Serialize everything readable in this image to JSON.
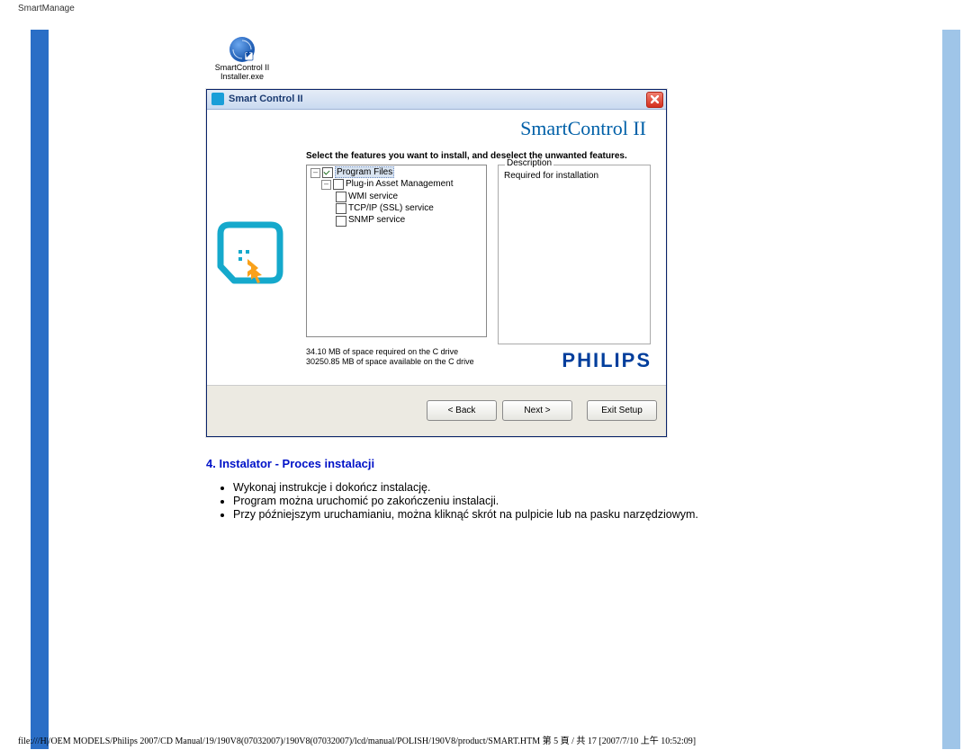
{
  "page_title": "SmartManage",
  "desktop_icon": {
    "line1": "SmartControl II",
    "line2": "Installer.exe"
  },
  "dialog": {
    "title": "Smart Control II",
    "brand_title": "SmartControl II",
    "instruction": "Select the features you want to install, and deselect the unwanted features.",
    "tree": {
      "program_files": "Program Files",
      "plugin_asset": "Plug-in Asset Management",
      "wmi": "WMI service",
      "tcpip": "TCP/IP (SSL) service",
      "snmp": "SNMP service"
    },
    "description": {
      "legend": "Description",
      "text": "Required for installation"
    },
    "space_line1": "34.10 MB of space required on the C drive",
    "space_line2": "30250.85 MB of space available on the C drive",
    "philips": "PHILIPS",
    "buttons": {
      "back": "<  Back",
      "next": "Next  >",
      "exit": "Exit Setup"
    }
  },
  "section_heading": "4. Instalator - Proces instalacji",
  "steps": [
    "Wykonaj instrukcje i dokończ instalację.",
    "Program można uruchomić po zakończeniu instalacji.",
    "Przy późniejszym uruchamianiu, można kliknąć skrót na pulpicie lub na pasku narzędziowym."
  ],
  "footer": "file:///H|/OEM MODELS/Philips 2007/CD Manual/19/190V8(07032007)/190V8(07032007)/lcd/manual/POLISH/190V8/product/SMART.HTM 第 5 頁 / 共 17  [2007/7/10 上午 10:52:09]"
}
